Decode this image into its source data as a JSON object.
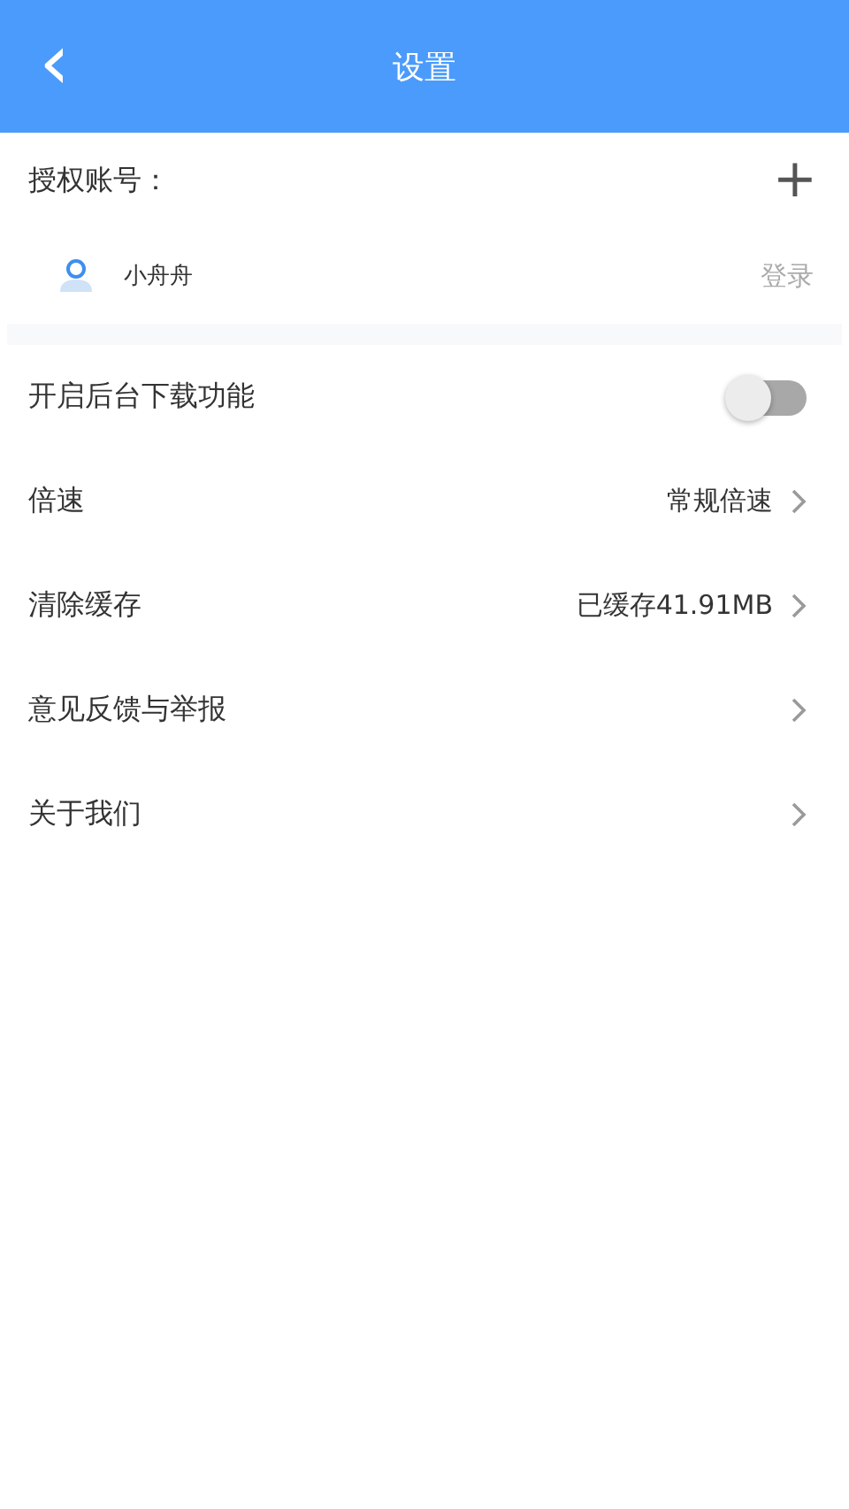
{
  "header": {
    "title": "设置",
    "back_icon": "‹"
  },
  "account": {
    "label": "授权账号：",
    "add": "+",
    "user": {
      "name": "小舟舟",
      "action": "登录"
    }
  },
  "settings": [
    {
      "kind": "toggle",
      "label": "开启后台下载功能",
      "on": false
    },
    {
      "kind": "link",
      "label": "倍速",
      "value": "常规倍速"
    },
    {
      "kind": "link",
      "label": "清除缓存",
      "value": "已缓存41.91MB"
    },
    {
      "kind": "link",
      "label": "意见反馈与举报"
    },
    {
      "kind": "link",
      "label": "关于我们"
    }
  ]
}
